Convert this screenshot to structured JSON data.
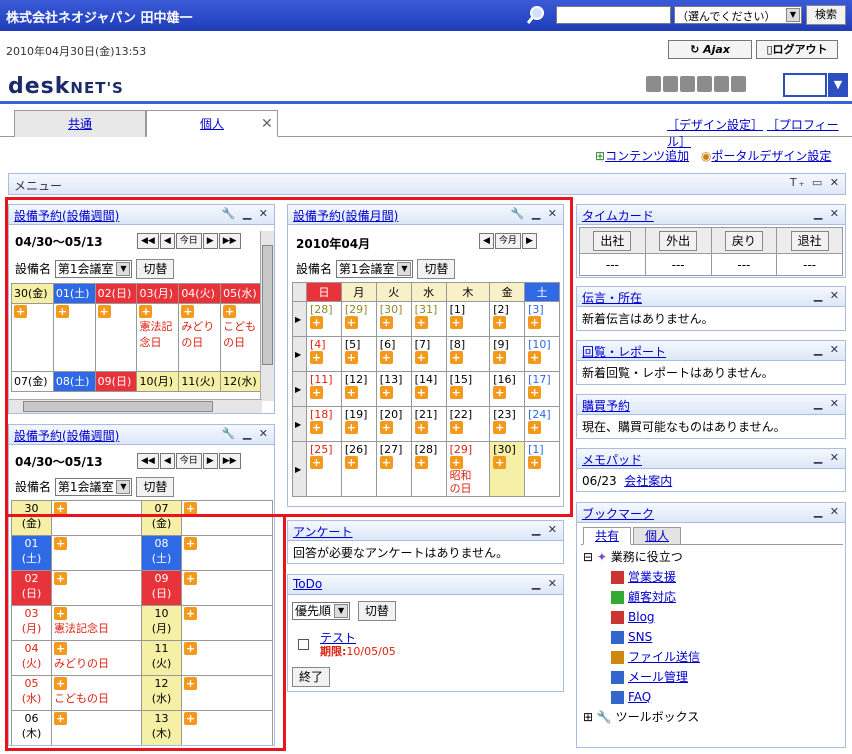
{
  "header": {
    "company": "株式会社ネオジャパン 田中雄一",
    "search_placeholder": "",
    "scope": "（選んでください）",
    "search_btn": "検索",
    "date": "2010年04月30日(金)13:53",
    "ajax": "Ajax",
    "logout": "ログアウト",
    "logo_big": "desk",
    "logo_small": "NET'S"
  },
  "tabs": {
    "tab1": "共通",
    "tab2": "個人",
    "close": "✕",
    "design_link": "［デザイン設定］",
    "profile_link": "［プロフィール］",
    "add_content": "コンテンツ追加",
    "portal_design": "ポータルデザイン設定"
  },
  "menu": {
    "title": "メニュー"
  },
  "weekly1": {
    "title": "設備予約(設備週間)",
    "range": "04/30～05/13",
    "today": "今日",
    "facility_label": "設備名",
    "facility": "第1会議室",
    "switch": "切替",
    "days1": [
      "30(金)",
      "01(土)",
      "02(日)",
      "03(月)",
      "04(火)",
      "05(水)"
    ],
    "events1": [
      "",
      "",
      "",
      "憲法記念日",
      "みどりの日",
      "こどもの日"
    ],
    "days2": [
      "07(金)",
      "08(土)",
      "09(日)",
      "10(月)",
      "11(火)",
      "12(水)"
    ]
  },
  "weekly2": {
    "title": "設備予約(設備週間)",
    "range": "04/30～05/13",
    "today": "今日",
    "facility_label": "設備名",
    "facility": "第1会議室",
    "switch": "切替",
    "left": [
      {
        "d": "30\n(金)",
        "e": ""
      },
      {
        "d": "01\n(土)",
        "e": ""
      },
      {
        "d": "02\n(日)",
        "e": ""
      },
      {
        "d": "03\n(月)",
        "e": "憲法記念日"
      },
      {
        "d": "04\n(火)",
        "e": "みどりの日"
      },
      {
        "d": "05\n(水)",
        "e": "こどもの日"
      },
      {
        "d": "06\n(木)",
        "e": ""
      }
    ],
    "right": [
      {
        "d": "07\n(金)",
        "e": ""
      },
      {
        "d": "08\n(土)",
        "e": ""
      },
      {
        "d": "09\n(日)",
        "e": ""
      },
      {
        "d": "10\n(月)",
        "e": ""
      },
      {
        "d": "11\n(火)",
        "e": ""
      },
      {
        "d": "12\n(水)",
        "e": ""
      },
      {
        "d": "13\n(木)",
        "e": ""
      }
    ]
  },
  "monthly": {
    "title": "設備予約(設備月間)",
    "month": "2010年04月",
    "this_month": "今月",
    "facility_label": "設備名",
    "facility": "第1会議室",
    "switch": "切替",
    "weekdays": [
      "日",
      "月",
      "火",
      "水",
      "木",
      "金",
      "土"
    ],
    "weeks": [
      [
        "[28]",
        "[29]",
        "[30]",
        "[31]",
        "[1]",
        "[2]",
        "[3]"
      ],
      [
        "[4]",
        "[5]",
        "[6]",
        "[7]",
        "[8]",
        "[9]",
        "[10]"
      ],
      [
        "[11]",
        "[12]",
        "[13]",
        "[14]",
        "[15]",
        "[16]",
        "[17]"
      ],
      [
        "[18]",
        "[19]",
        "[20]",
        "[21]",
        "[22]",
        "[23]",
        "[24]"
      ],
      [
        "[25]",
        "[26]",
        "[27]",
        "[28]",
        "[29]",
        "[30]",
        "[1]"
      ]
    ],
    "holiday": "昭和の日"
  },
  "survey": {
    "title": "アンケート",
    "body": "回答が必要なアンケートはありません。"
  },
  "todo": {
    "title": "ToDo",
    "sort": "優先順",
    "switch": "切替",
    "item": "テスト",
    "due_label": "期限:",
    "due": "10/05/05",
    "done": "終了"
  },
  "timecard": {
    "title": "タイムカード",
    "buttons": [
      "出社",
      "外出",
      "戻り",
      "退社"
    ],
    "values": [
      "---",
      "---",
      "---",
      "---"
    ]
  },
  "message": {
    "title": "伝言・所在",
    "body": "新着伝言はありません。"
  },
  "circular": {
    "title": "回覧・レポート",
    "body": "新着回覧・レポートはありません。"
  },
  "purchase": {
    "title": "購買予約",
    "body": "現在、購買可能なものはありません。"
  },
  "memo": {
    "title": "メモパッド",
    "date": "06/23",
    "link": "会社案内"
  },
  "bookmark": {
    "title": "ブックマーク",
    "tab1": "共有",
    "tab2": "個人",
    "folder": "業務に役立つ",
    "items": [
      "営業支援",
      "顧客対応",
      "Blog",
      "SNS",
      "ファイル送信",
      "メール管理",
      "FAQ"
    ],
    "toolbox": "ツールボックス"
  },
  "colors": {
    "saturday": "#2f6ae6",
    "sunday": "#e8333b",
    "today": "#f5f0a6",
    "accent": "#e8141e"
  }
}
